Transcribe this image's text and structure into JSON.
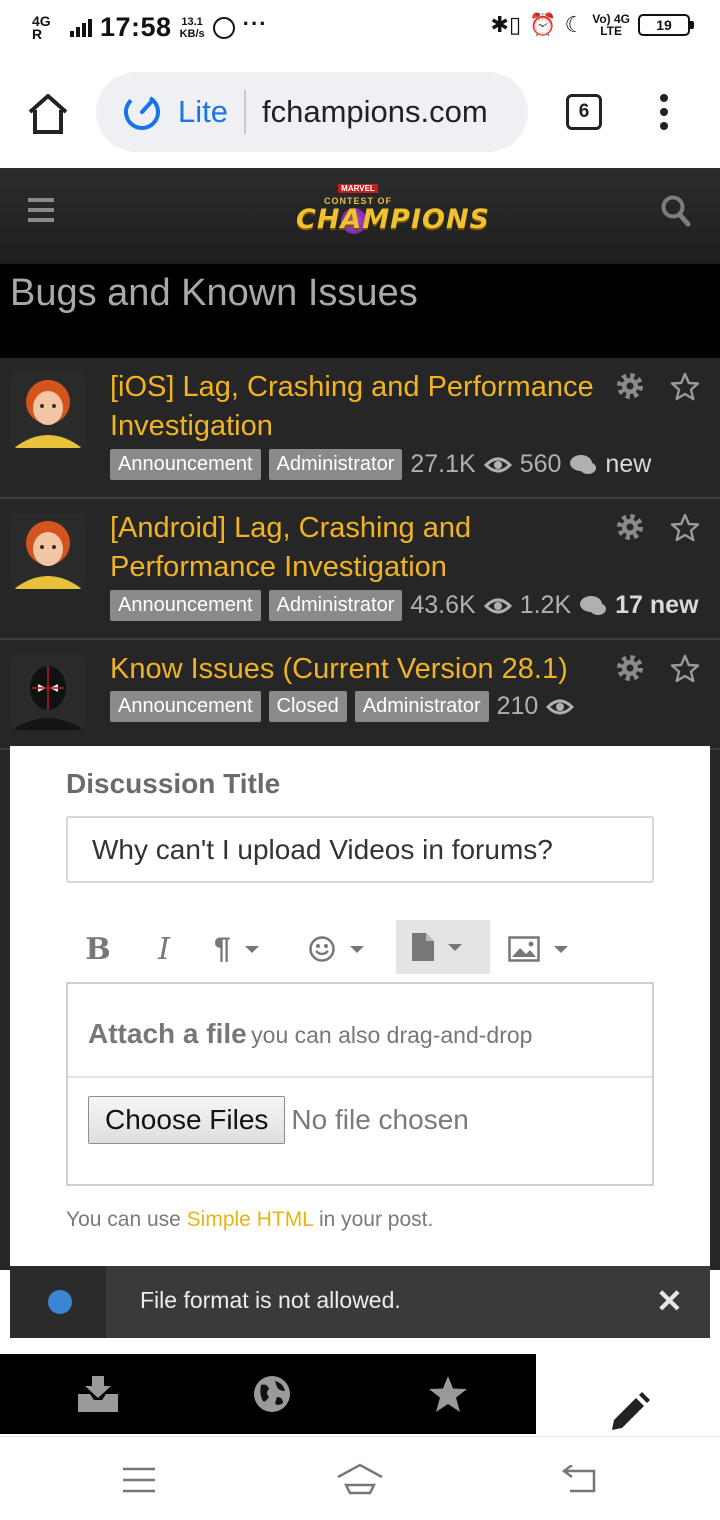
{
  "status_bar": {
    "network": "4G",
    "time": "17:58",
    "speed_value": "13.1",
    "speed_unit": "KB/s",
    "more": "···",
    "volte": "Vo) 4G",
    "lte": "LTE",
    "battery": "19"
  },
  "browser": {
    "lite_label": "Lite",
    "url": "fchampions.com",
    "tab_count": "6"
  },
  "site": {
    "logo_marvel": "MARVEL",
    "logo_sub": "CONTEST OF",
    "logo_main": "CHAMPIONS"
  },
  "forum": {
    "title": "Bugs and Known Issues"
  },
  "discussions": [
    {
      "title": "[iOS] Lag, Crashing and Performance Investigation",
      "tags": [
        "Announcement",
        "Administrator"
      ],
      "views": "27.1K",
      "comments": "560",
      "new": "new"
    },
    {
      "title": "[Android] Lag, Crashing and Performance Investigation",
      "tags": [
        "Announcement",
        "Administrator"
      ],
      "views": "43.6K",
      "comments": "1.2K",
      "new": "17 new"
    },
    {
      "title": "Know Issues (Current Version 28.1)",
      "tags": [
        "Announcement",
        "Closed",
        "Administrator"
      ],
      "views": "210"
    }
  ],
  "modal": {
    "title_label": "Discussion Title",
    "title_value": "Why can't I upload Videos in forums?",
    "attach_title": "Attach a file",
    "attach_sub": "you can also drag-and-drop",
    "choose_files": "Choose Files",
    "no_file": "No file chosen",
    "help_pre": "You can use",
    "help_link": "Simple HTML",
    "help_post": "in your post."
  },
  "toast": {
    "message": "File format is not allowed.",
    "dot_color": "#3a86d4"
  },
  "colors": {
    "accent_gold": "#f0b323",
    "browser_blue": "#1a73e8"
  },
  "icons": {
    "bottom_nav": [
      "inbox-icon",
      "globe-icon",
      "star-icon",
      "pencil-icon"
    ]
  }
}
